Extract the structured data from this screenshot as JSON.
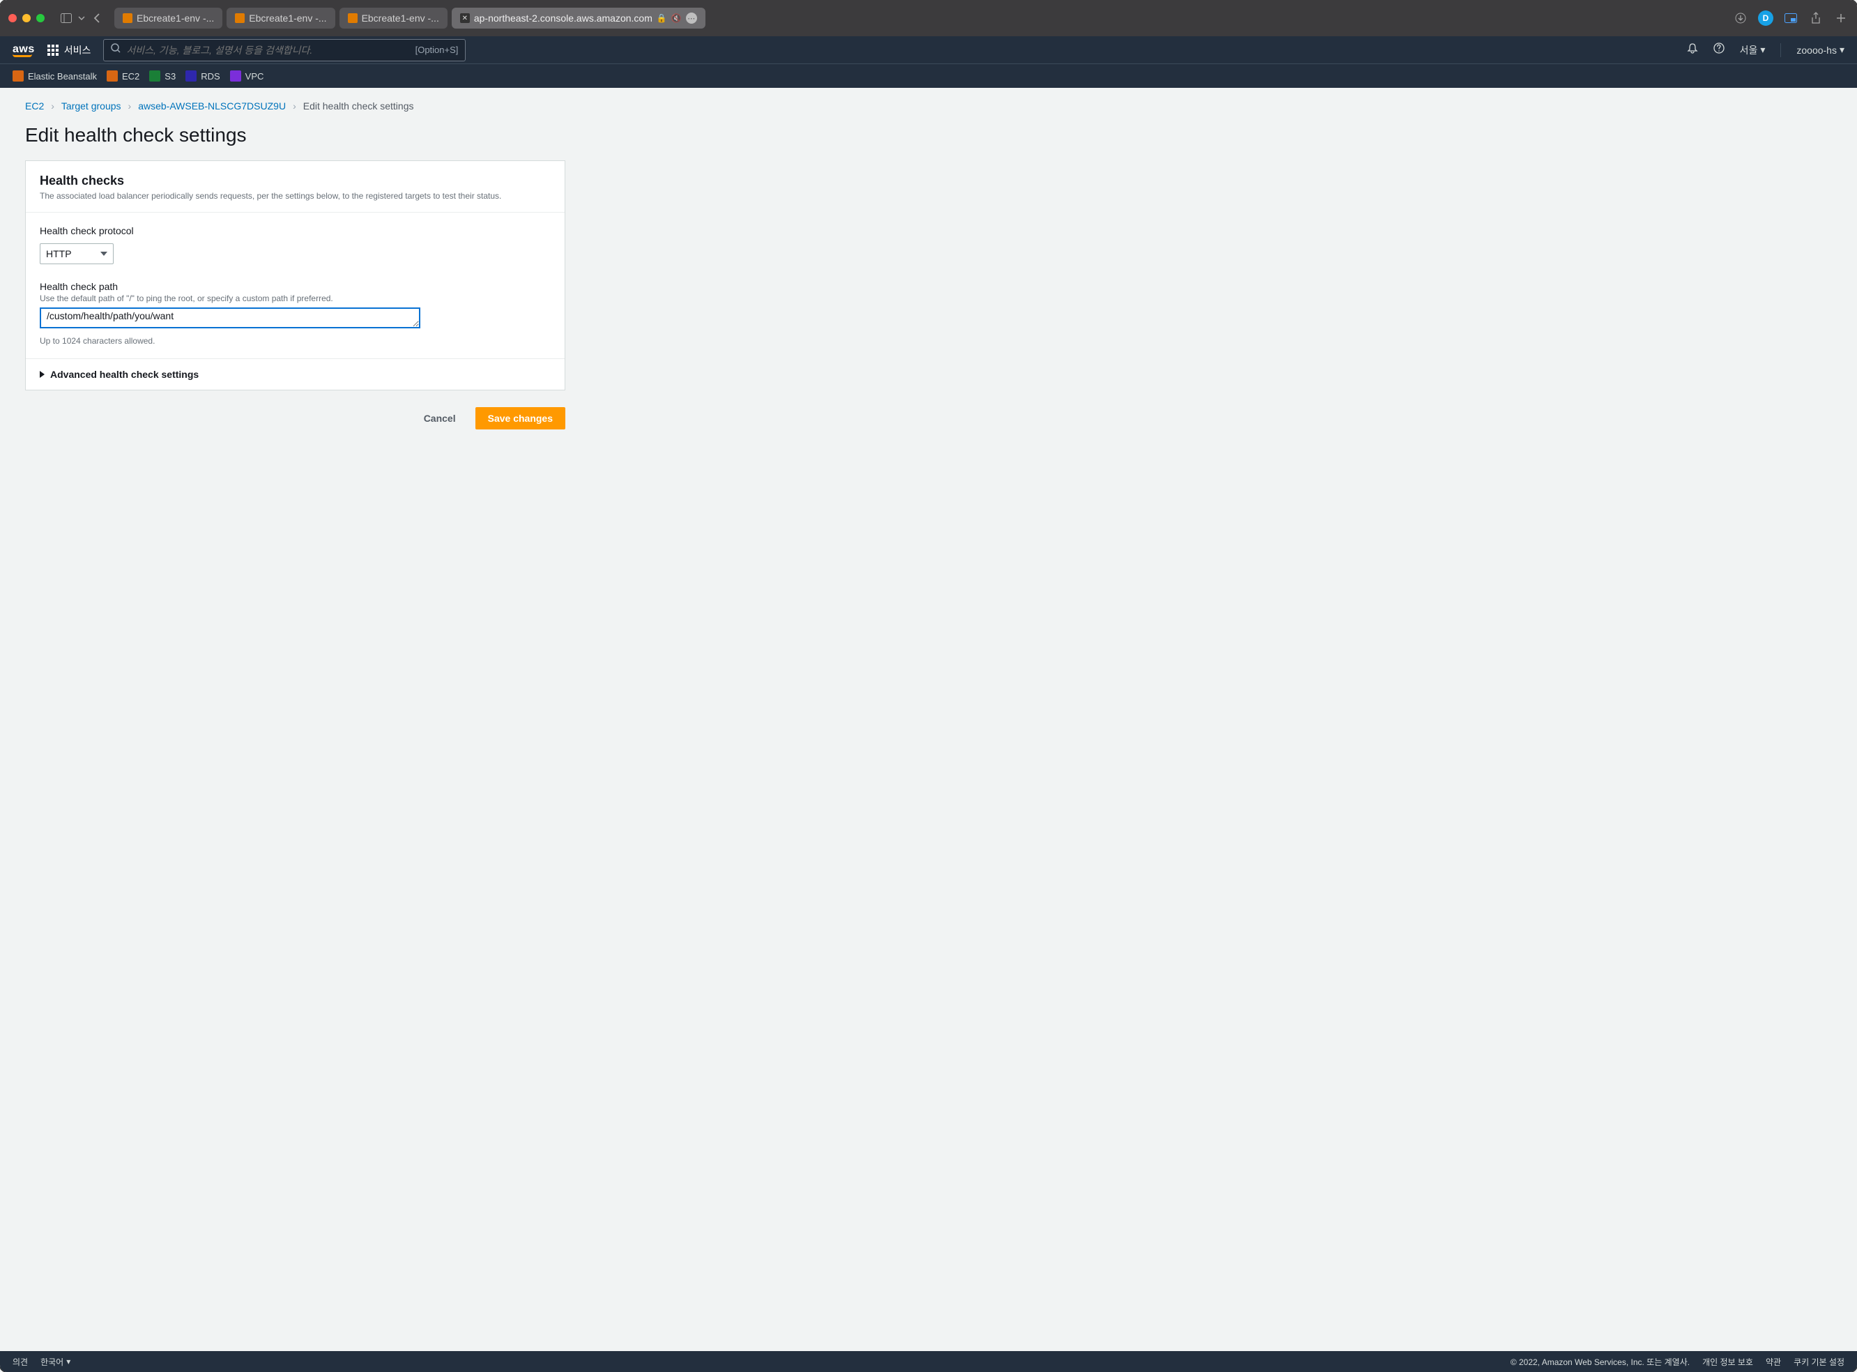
{
  "browser": {
    "tabs": [
      {
        "label": "Ebcreate1-env -...",
        "kind": "eb"
      },
      {
        "label": "Ebcreate1-env -...",
        "kind": "eb"
      },
      {
        "label": "Ebcreate1-env -...",
        "kind": "eb"
      }
    ],
    "active_tab": {
      "label": "ap-northeast-2.console.aws.amazon.com"
    }
  },
  "aws_nav": {
    "services_label": "서비스",
    "search_placeholder": "서비스, 기능, 블로그, 설명서 등을 검색합니다.",
    "search_shortcut": "[Option+S]",
    "region": "서울",
    "account": "zoooo-hs"
  },
  "service_bar": {
    "items": [
      {
        "label": "Elastic Beanstalk",
        "cls": "svc-eb"
      },
      {
        "label": "EC2",
        "cls": "svc-ec2"
      },
      {
        "label": "S3",
        "cls": "svc-s3"
      },
      {
        "label": "RDS",
        "cls": "svc-rds"
      },
      {
        "label": "VPC",
        "cls": "svc-vpc"
      }
    ]
  },
  "breadcrumbs": {
    "items": [
      {
        "label": "EC2",
        "link": true
      },
      {
        "label": "Target groups",
        "link": true
      },
      {
        "label": "awseb-AWSEB-NLSCG7DSUZ9U",
        "link": true
      },
      {
        "label": "Edit health check settings",
        "link": false
      }
    ]
  },
  "page": {
    "title": "Edit health check settings",
    "panel_title": "Health checks",
    "panel_desc": "The associated load balancer periodically sends requests, per the settings below, to the registered targets to test their status.",
    "protocol_label": "Health check protocol",
    "protocol_value": "HTTP",
    "path_label": "Health check path",
    "path_help": "Use the default path of \"/\" to ping the root, or specify a custom path if preferred.",
    "path_value": "/custom/health/path/you/want",
    "path_constraint": "Up to 1024 characters allowed.",
    "advanced_label": "Advanced health check settings",
    "cancel_label": "Cancel",
    "save_label": "Save changes"
  },
  "footer": {
    "feedback": "의견",
    "language": "한국어",
    "copyright": "© 2022, Amazon Web Services, Inc. 또는 계열사.",
    "privacy": "개인 정보 보호",
    "terms": "약관",
    "cookies": "쿠키 기본 설정"
  }
}
